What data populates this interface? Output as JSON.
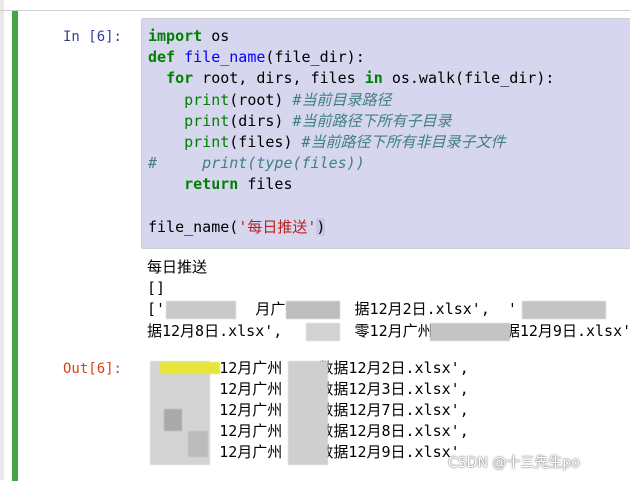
{
  "cell": {
    "in_prompt": "In  [6]:",
    "out_prompt": "Out[6]:",
    "code": {
      "line1_kw": "import",
      "line1_rest": " os",
      "line2_kw": "def",
      "line2_fn": "file_name",
      "line2_rest": "(file_dir):",
      "line3_kw": "for",
      "line3_a": " root, dirs, files ",
      "line3_kw2": "in",
      "line3_b": " os.walk(file_dir):",
      "line4_bi": "print",
      "line4_a": "(root) ",
      "line4_cm": "#当前目录路径",
      "line5_bi": "print",
      "line5_a": "(dirs) ",
      "line5_cm": "#当前路径下所有子目录",
      "line6_bi": "print",
      "line6_a": "(files) ",
      "line6_cm": "#当前路径下所有非目录子文件",
      "line7_cm": "#     print(type(files))",
      "line8_kw": "return",
      "line8_rest": " files",
      "line10_fn": "file_name(",
      "line10_str": "'每日推送'",
      "line10_end": ")"
    },
    "stdout": [
      "每日推送",
      "[]",
      "['          月广州      据12月2日.xlsx',  '             州",
      "据12月8日.xlsx',        零12月广州        据12月9日.xlsx']"
    ],
    "output": [
      "        12月广州    数据12月2日.xlsx',",
      "        12月广州    数据12月3日.xlsx',",
      "        12月广州    数据12月7日.xlsx',",
      "        12月广州    数据12月8日.xlsx',",
      "        12月广州    数据12月9日.xlsx'"
    ]
  },
  "watermark": "CSDN @十三先生po",
  "colors": {
    "selected_bar": "#42a548",
    "editor_bg": "#d6d6ee",
    "prompt_in": "#303f9f",
    "prompt_out": "#d84315",
    "keyword": "#008000",
    "comment": "#408080",
    "string": "#ba2121",
    "function": "#0000ff"
  }
}
